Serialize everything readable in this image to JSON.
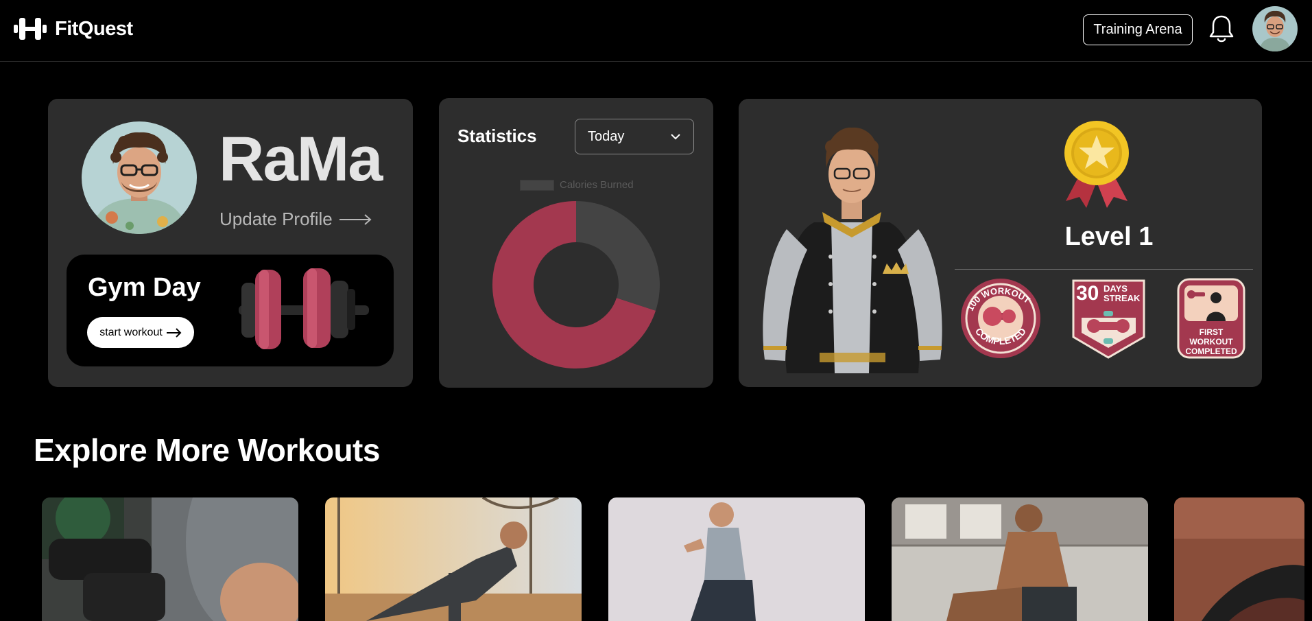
{
  "header": {
    "brand": "FitQuest",
    "arena_button": "Training Arena",
    "icons": [
      "dumbbell-logo-icon",
      "bell-icon",
      "user-avatar"
    ]
  },
  "profile": {
    "name": "RaMa",
    "update_link": "Update Profile",
    "gym_title": "Gym Day",
    "start_button": "start workout"
  },
  "statistics": {
    "title": "Statistics",
    "period": "Today",
    "legend": "Calories Burned"
  },
  "chart_data": {
    "type": "pie",
    "categories": [
      "",
      ""
    ],
    "values": [
      70,
      30
    ],
    "colors": [
      "#a3384f",
      "#444444"
    ],
    "legend": "Calories Burned",
    "style": "donut"
  },
  "level": {
    "label": "Level 1",
    "badges": [
      "100 WORKOUT COMPLETED",
      "30 DAYS STREAK",
      "FIRST WORKOUT COMPLETED"
    ]
  },
  "explore": {
    "title": "Explore More Workouts",
    "cards": [
      "dumbbell-curl",
      "push-up",
      "squat",
      "sit-up",
      "partial"
    ]
  },
  "colors": {
    "accent": "#a3384f",
    "card": "#2d2d2d",
    "background": "#000000"
  }
}
